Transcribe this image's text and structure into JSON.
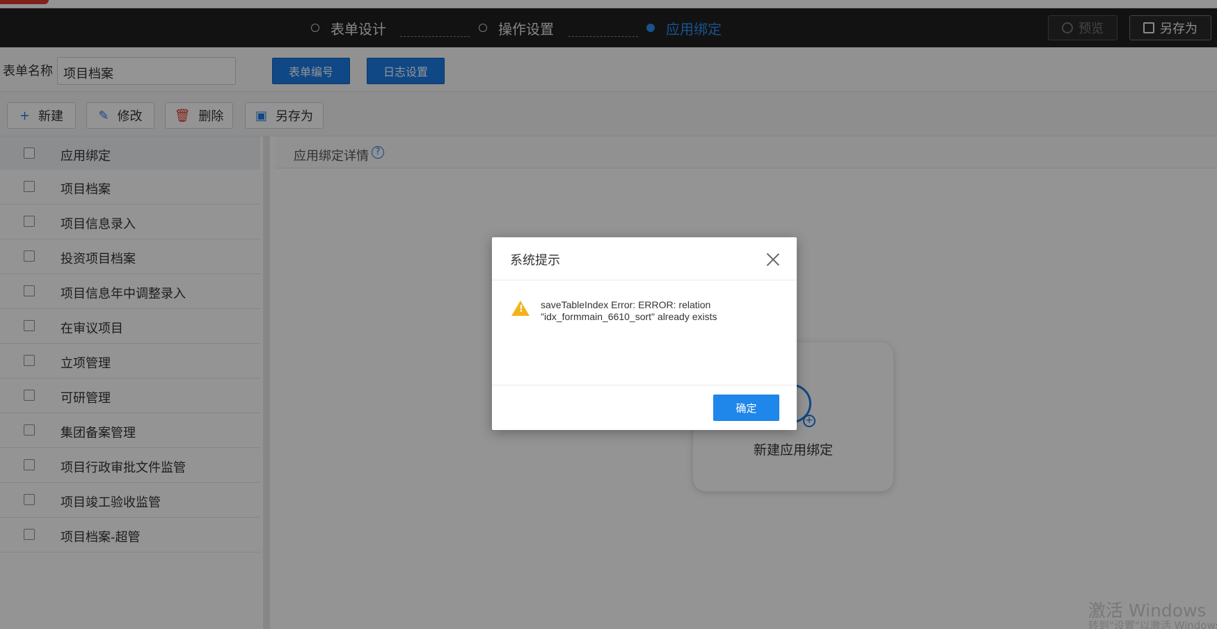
{
  "stepbar": {
    "steps": [
      {
        "label": "表单设计"
      },
      {
        "label": "操作设置"
      },
      {
        "label": "应用绑定"
      }
    ],
    "preview_label": "预览",
    "saveas_label": "另存为"
  },
  "form": {
    "name_label": "表单名称",
    "name_value": "项目档案",
    "btn_form_number": "表单编号",
    "btn_log_settings": "日志设置"
  },
  "toolbar": {
    "new_label": "新建",
    "edit_label": "修改",
    "delete_label": "删除",
    "saveas_label": "另存为"
  },
  "list": {
    "header": "应用绑定",
    "items": [
      "项目档案",
      "项目信息录入",
      "投资项目档案",
      "项目信息年中调整录入",
      "在审议项目",
      "立项管理",
      "可研管理",
      "集团备案管理",
      "项目行政审批文件监管",
      "项目竣工验收监管",
      "项目档案-超管"
    ]
  },
  "detail": {
    "title": "应用绑定详情",
    "help_glyph": "?",
    "new_binding_label": "新建应用绑定"
  },
  "dialog": {
    "title": "系统提示",
    "message": "saveTableIndex Error: ERROR: relation \"idx_formmain_6610_sort\" already exists",
    "ok_label": "确定"
  },
  "watermark": {
    "line1": "激活 Windows",
    "line2": "转到\"设置\"以激活 Windows"
  },
  "colors": {
    "accent": "#1d7ae6",
    "stepbar_bg": "#1f1f1f",
    "warning": "#f3b41a",
    "danger": "#e03a2f"
  }
}
